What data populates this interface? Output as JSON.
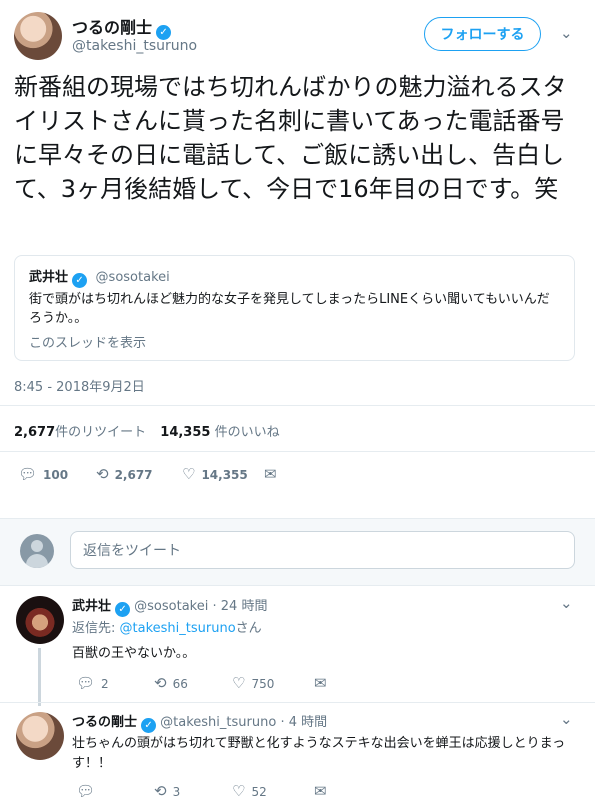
{
  "main_tweet": {
    "author_name": "つるの剛士",
    "author_handle": "@takeshi_tsuruno",
    "follow_label": "フォローする",
    "text": "新番組の現場ではち切れんばかりの魅力溢れるスタイリストさんに貰った名刺に書いてあった電話番号に早々その日に電話して、ご飯に誘い出し、告白して、3ヶ月後結婚して、今日で16年目の日です。笑",
    "quote": {
      "author_name": "武井壮",
      "author_handle": "@sosotakei",
      "text": "街で頭がはち切れんほど魅力的な女子を発見してしまったらLINEくらい聞いてもいいんだろうか。。",
      "thread_link": "このスレッドを表示"
    },
    "timestamp": "8:45 - 2018年9月2日",
    "retweet_count": "2,677",
    "retweet_label": "件のリツイート",
    "like_count": "14,355",
    "like_label": "件のいいね",
    "actions": {
      "reply": "100",
      "retweet": "2,677",
      "like": "14,355"
    }
  },
  "reply_box": {
    "placeholder": "返信をツイート"
  },
  "replies": [
    {
      "author_name": "武井壮",
      "author_handle": "@sosotakei",
      "time": "· 24 時間",
      "reply_to_prefix": "返信先: ",
      "reply_to_handle": "@takeshi_tsuruno",
      "reply_to_suffix": "さん",
      "text": "百獣の王やないか。。",
      "reply": "2",
      "retweet": "66",
      "like": "750"
    },
    {
      "author_name": "つるの剛士",
      "author_handle": "@takeshi_tsuruno",
      "time": "· 4 時間",
      "text": "壮ちゃんの頭がはち切れて野獣と化すようなステキな出会いを蝉王は応援しとりまっす！！",
      "reply": "",
      "retweet": "3",
      "like": "52"
    }
  ],
  "colors": {
    "accent": "#1da1f2",
    "text": "#14171a",
    "muted": "#657786"
  }
}
